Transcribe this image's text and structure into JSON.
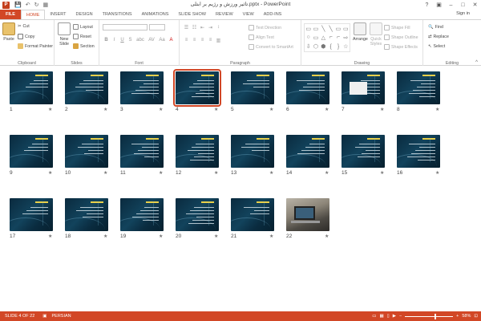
{
  "app": {
    "title": "تاثیر ورزش و رژیم بر ابتلی.pptx - PowerPoint",
    "icon_letter": "P",
    "sign_in": "Sign in",
    "qat": {
      "save": "💾",
      "undo": "↶",
      "redo": "↻",
      "present": "▦"
    }
  },
  "tabs": [
    "FILE",
    "HOME",
    "INSERT",
    "DESIGN",
    "TRANSITIONS",
    "ANIMATIONS",
    "SLIDE SHOW",
    "REVIEW",
    "VIEW",
    "ADD-INS"
  ],
  "active_tab": "HOME",
  "ribbon": {
    "clipboard": {
      "paste": "Paste",
      "cut": "Cut",
      "copy": "Copy",
      "format_painter": "Format Painter",
      "label": "Clipboard"
    },
    "slides": {
      "new_slide_1": "New",
      "new_slide_2": "Slide",
      "layout": "Layout",
      "reset": "Reset",
      "section": "Section",
      "label": "Slides"
    },
    "font": {
      "label": "Font",
      "bold": "B",
      "italic": "I",
      "underline": "U",
      "strike": "S",
      "shadow": "abc",
      "spacing": "AV",
      "case": "Aa",
      "color": "A"
    },
    "paragraph": {
      "text_direction": "Text Direction",
      "align_text": "Align Text",
      "convert_smartart": "Convert to SmartArt",
      "label": "Paragraph"
    },
    "drawing": {
      "arrange": "Arrange",
      "quick_styles_1": "Quick",
      "quick_styles_2": "Styles",
      "shape_fill": "Shape Fill",
      "shape_outline": "Shape Outline",
      "shape_effects": "Shape Effects",
      "label": "Drawing",
      "shapes": [
        "▭",
        "▭",
        "╲",
        "╲",
        "▭",
        "▭",
        "○",
        "▭",
        "△",
        "⌐",
        "⌐",
        "⇨",
        "⇩",
        "⬡",
        "⬢",
        "{",
        "}",
        "☆"
      ]
    },
    "editing": {
      "find": "Find",
      "replace": "Replace",
      "select": "Select",
      "label": "Editing"
    }
  },
  "slides": [
    {
      "num": "1",
      "star": "★"
    },
    {
      "num": "2",
      "star": "★"
    },
    {
      "num": "3",
      "star": "★"
    },
    {
      "num": "4",
      "star": "★"
    },
    {
      "num": "5",
      "star": "★"
    },
    {
      "num": "6",
      "star": "★"
    },
    {
      "num": "7",
      "star": "★"
    },
    {
      "num": "8",
      "star": "★"
    },
    {
      "num": "9",
      "star": "★"
    },
    {
      "num": "10",
      "star": "★"
    },
    {
      "num": "11",
      "star": "★"
    },
    {
      "num": "12",
      "star": "★"
    },
    {
      "num": "13",
      "star": "★"
    },
    {
      "num": "14",
      "star": "★"
    },
    {
      "num": "15",
      "star": "★"
    },
    {
      "num": "16",
      "star": "★"
    },
    {
      "num": "17",
      "star": "★"
    },
    {
      "num": "18",
      "star": "★"
    },
    {
      "num": "19",
      "star": "★"
    },
    {
      "num": "20",
      "star": "★"
    },
    {
      "num": "21",
      "star": "★"
    },
    {
      "num": "22",
      "star": "★"
    }
  ],
  "selected_slide": "4",
  "status": {
    "slide_info": "SLIDE 4 OF 22",
    "language": "PERSIAN",
    "zoom": "58%",
    "zoom_level_percent": 58
  },
  "colors": {
    "accent": "#d24726",
    "slide_bg": "#0f3a52",
    "title_yellow": "#e8d04a"
  }
}
